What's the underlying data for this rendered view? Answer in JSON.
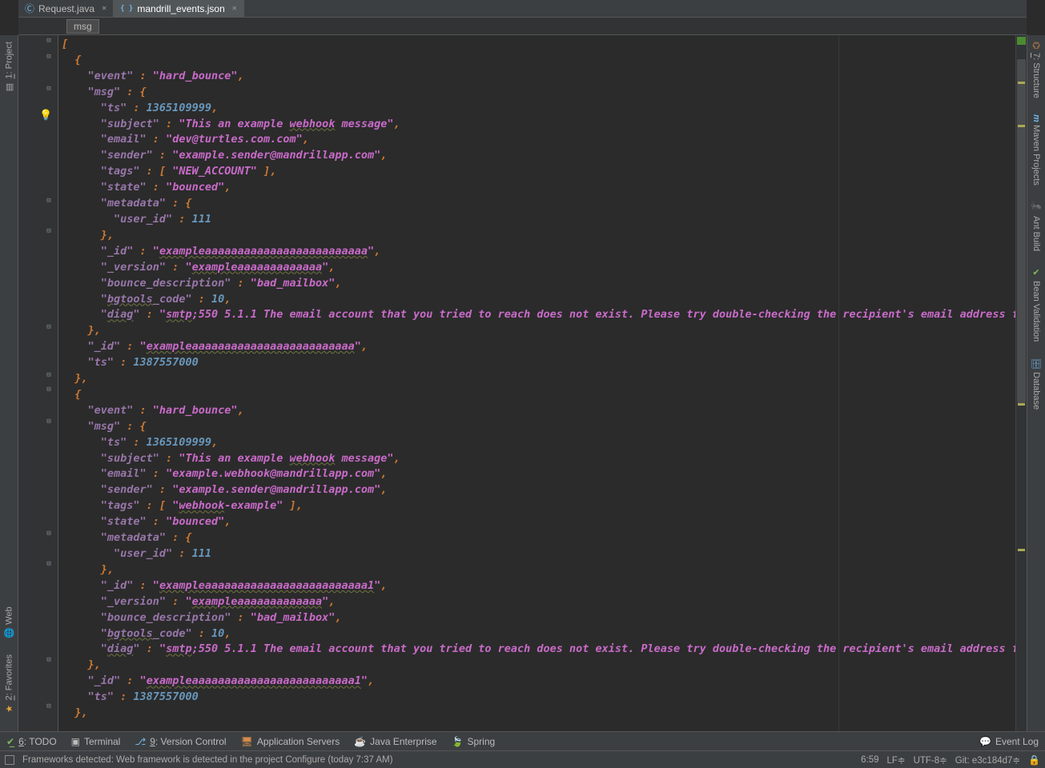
{
  "tabs": [
    {
      "label": "Request.java",
      "active": false,
      "icon": "C"
    },
    {
      "label": "mandrill_events.json",
      "active": true,
      "icon": "JSON"
    }
  ],
  "breadcrumb": "msg",
  "left_tools": {
    "project": {
      "num": "1",
      "label": "Project"
    },
    "web": "Web",
    "favorites": {
      "num": "2",
      "label": "Favorites"
    }
  },
  "right_tools": {
    "structure": {
      "num": "7",
      "label": "Structure"
    },
    "maven": "Maven Projects",
    "ant": "Ant Build",
    "bean": "Bean Validation",
    "database": "Database"
  },
  "code": {
    "l01": "[",
    "l02": "  {",
    "l03a": "    \"event\"",
    "l03b": " : ",
    "l03c": "\"hard_bounce\"",
    "l03d": ",",
    "l04a": "    \"msg\"",
    "l04b": " : {",
    "l05a": "      \"ts\"",
    "l05b": " : ",
    "l05c": "1365109999",
    "l05d": ",",
    "l06a": "      \"subject\"",
    "l06b": " : ",
    "l06c": "\"This an example ",
    "l06d": "webhook",
    "l06e": " message\"",
    "l06f": ",",
    "l07a": "      \"email\"",
    "l07b": " : ",
    "l07c": "\"dev@turtles.com.com\"",
    "l07d": ",",
    "l08a": "      \"sender\"",
    "l08b": " : ",
    "l08c": "\"example.sender@mandrillapp.com\"",
    "l08d": ",",
    "l09a": "      \"tags\"",
    "l09b": " : [ ",
    "l09c": "\"NEW_ACCOUNT\"",
    "l09d": " ],",
    "l10a": "      \"state\"",
    "l10b": " : ",
    "l10c": "\"bounced\"",
    "l10d": ",",
    "l11a": "      \"metadata\"",
    "l11b": " : {",
    "l12a": "        \"user_id\"",
    "l12b": " : ",
    "l12c": "111",
    "l13": "      },",
    "l14a": "      \"_id\"",
    "l14b": " : ",
    "l14c": "\"",
    "l14d": "exampleaaaaaaaaaaaaaaaaaaaaaaaaa",
    "l14e": "\"",
    "l14f": ",",
    "l15a": "      \"_version\"",
    "l15b": " : ",
    "l15c": "\"",
    "l15d": "exampleaaaaaaaaaaaaa",
    "l15e": "\"",
    "l15f": ",",
    "l16a": "      \"bounce_description\"",
    "l16b": " : ",
    "l16c": "\"bad_mailbox\"",
    "l16d": ",",
    "l17a": "      \"",
    "l17b": "bgtools",
    "l17c": "_code\"",
    "l17d": " : ",
    "l17e": "10",
    "l17f": ",",
    "l18a": "      \"",
    "l18b": "diag",
    "l18c": "\"",
    "l18d": " : ",
    "l18e": "\"",
    "l18f": "smtp",
    "l18g": ";550 5.1.1 The email account that you tried to reach does not exist. Please try double-checking the recipient's email address f",
    "l19": "    },",
    "l20a": "    \"_id\"",
    "l20b": " : ",
    "l20c": "\"",
    "l20d": "exampleaaaaaaaaaaaaaaaaaaaaaaaaa",
    "l20e": "\"",
    "l20f": ",",
    "l21a": "    \"ts\"",
    "l21b": " : ",
    "l21c": "1387557000",
    "l22": "  },",
    "l23": "  {",
    "l24a": "    \"event\"",
    "l24b": " : ",
    "l24c": "\"hard_bounce\"",
    "l24d": ",",
    "l25a": "    \"msg\"",
    "l25b": " : {",
    "l26a": "      \"ts\"",
    "l26b": " : ",
    "l26c": "1365109999",
    "l26d": ",",
    "l27a": "      \"subject\"",
    "l27b": " : ",
    "l27c": "\"This an example ",
    "l27d": "webhook",
    "l27e": " message\"",
    "l27f": ",",
    "l28a": "      \"email\"",
    "l28b": " : ",
    "l28c": "\"example.webhook@mandrillapp.com\"",
    "l28d": ",",
    "l29a": "      \"sender\"",
    "l29b": " : ",
    "l29c": "\"example.sender@mandrillapp.com\"",
    "l29d": ",",
    "l30a": "      \"tags\"",
    "l30b": " : [ ",
    "l30c": "\"",
    "l30d": "webhook",
    "l30e": "-example\"",
    "l30f": " ],",
    "l31a": "      \"state\"",
    "l31b": " : ",
    "l31c": "\"bounced\"",
    "l31d": ",",
    "l32a": "      \"metadata\"",
    "l32b": " : {",
    "l33a": "        \"user_id\"",
    "l33b": " : ",
    "l33c": "111",
    "l34": "      },",
    "l35a": "      \"_id\"",
    "l35b": " : ",
    "l35c": "\"",
    "l35d": "exampleaaaaaaaaaaaaaaaaaaaaaaaaa1",
    "l35e": "\"",
    "l35f": ",",
    "l36a": "      \"_version\"",
    "l36b": " : ",
    "l36c": "\"",
    "l36d": "exampleaaaaaaaaaaaaa",
    "l36e": "\"",
    "l36f": ",",
    "l37a": "      \"bounce_description\"",
    "l37b": " : ",
    "l37c": "\"bad_mailbox\"",
    "l37d": ",",
    "l38a": "      \"",
    "l38b": "bgtools",
    "l38c": "_code\"",
    "l38d": " : ",
    "l38e": "10",
    "l38f": ",",
    "l39a": "      \"",
    "l39b": "diag",
    "l39c": "\"",
    "l39d": " : ",
    "l39e": "\"",
    "l39f": "smtp",
    "l39g": ";550 5.1.1 The email account that you tried to reach does not exist. Please try double-checking the recipient's email address f",
    "l40": "    },",
    "l41a": "    \"_id\"",
    "l41b": " : ",
    "l41c": "\"",
    "l41d": "exampleaaaaaaaaaaaaaaaaaaaaaaaaa1",
    "l41e": "\"",
    "l41f": ",",
    "l42a": "    \"ts\"",
    "l42b": " : ",
    "l42c": "1387557000",
    "l43": "  },"
  },
  "bottom": {
    "todo_num": "6",
    "todo": "TODO",
    "terminal": "Terminal",
    "vc_num": "9",
    "vc": "Version Control",
    "appservers": "Application Servers",
    "javaee": "Java Enterprise",
    "spring": "Spring",
    "eventlog": "Event Log"
  },
  "status": {
    "msg": "Frameworks detected: Web framework is detected in the project Configure (today 7:37 AM)",
    "pos": "6:59",
    "le": "LF≑",
    "enc": "UTF-8≑",
    "git": "Git: e3c184d7≑"
  }
}
